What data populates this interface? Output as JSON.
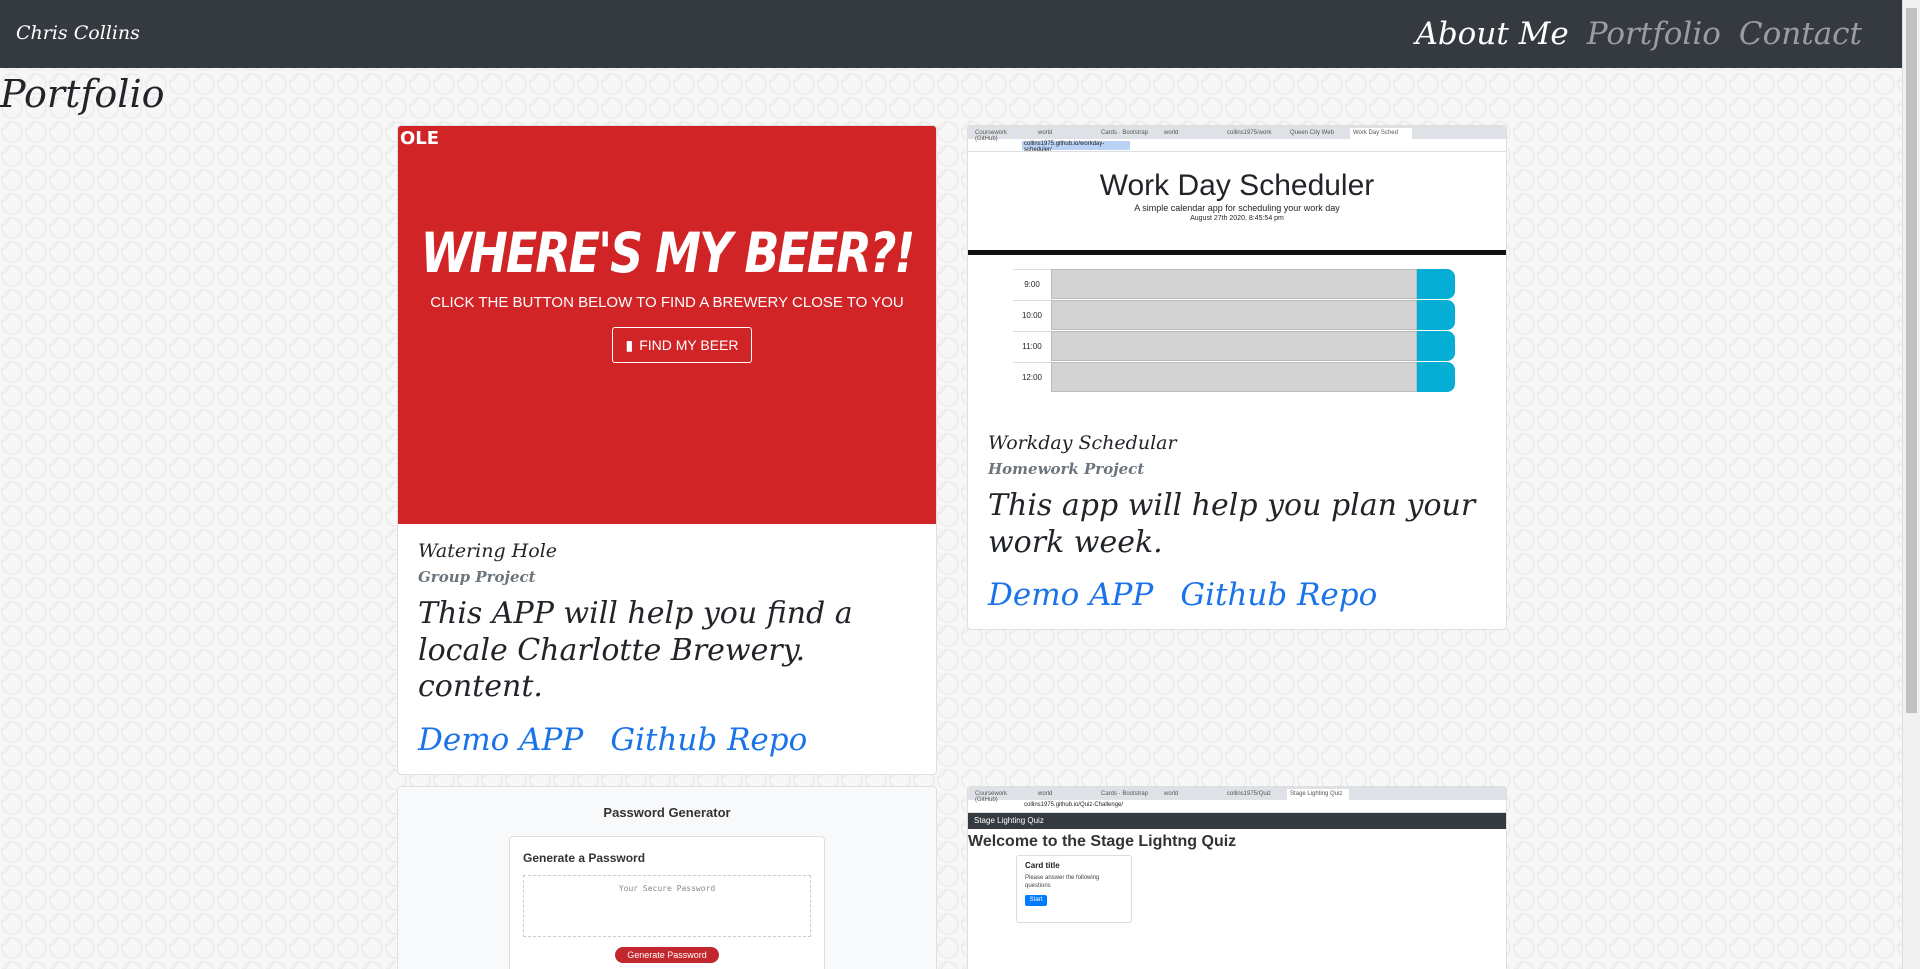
{
  "nav": {
    "brand": "Chris Collins",
    "links": [
      "About Me",
      "Portfolio",
      "Contact"
    ]
  },
  "page_title": "Portfolio",
  "projects": [
    {
      "title": "Watering Hole",
      "subtitle": "Group Project",
      "text": "This APP will help you find a locale Charlotte Brewery. content.",
      "demo": "Demo APP",
      "repo": "Github Repo",
      "image": {
        "corner": "OLE",
        "headline": "WHERE'S MY BEER?!",
        "sub": "CLICK THE BUTTON BELOW TO FIND A BREWERY CLOSE TO YOU",
        "button": "FIND MY BEER"
      }
    },
    {
      "title": "Workday Schedular",
      "subtitle": "Homework Project",
      "text": "This app will help you plan your work week.",
      "demo": "Demo APP",
      "repo": "Github Repo",
      "image": {
        "headline": "Work Day Scheduler",
        "sub": "A simple calendar app for scheduling your work day",
        "date": "August 27th 2020, 8:45:54 pm",
        "hours": [
          "9:00",
          "10:00",
          "11:00",
          "12:00"
        ],
        "url": "collins1975.github.io/workday-scheduler/",
        "tabs": [
          "Coursework (GitHub)",
          "world",
          "Cards · Bootstrap",
          "world",
          "collins1975/work",
          "Queen City Web",
          "Work Day Sched"
        ]
      }
    },
    {
      "image": {
        "headline": "Password Generator",
        "box_title": "Generate a Password",
        "placeholder": "Your Secure Password",
        "button": "Generate Password"
      }
    },
    {
      "image": {
        "nav": "Stage Lighting Quiz",
        "headline": "Welcome to the Stage Lightng Quiz",
        "card_title": "Card title",
        "card_text": "Please answer the following questions",
        "button": "Start",
        "url": "collins1975.github.io/Quiz-Challenge/",
        "tabs": [
          "Coursework (GitHub)",
          "world",
          "Cards · Bootstrap",
          "world",
          "collins1975/Quiz",
          "Stage Lighting Quiz"
        ]
      }
    }
  ],
  "colors": {
    "navbar": "#343a40",
    "link": "#1a73e8",
    "beer_red": "#d12426",
    "scheduler_save": "#06aed5"
  }
}
